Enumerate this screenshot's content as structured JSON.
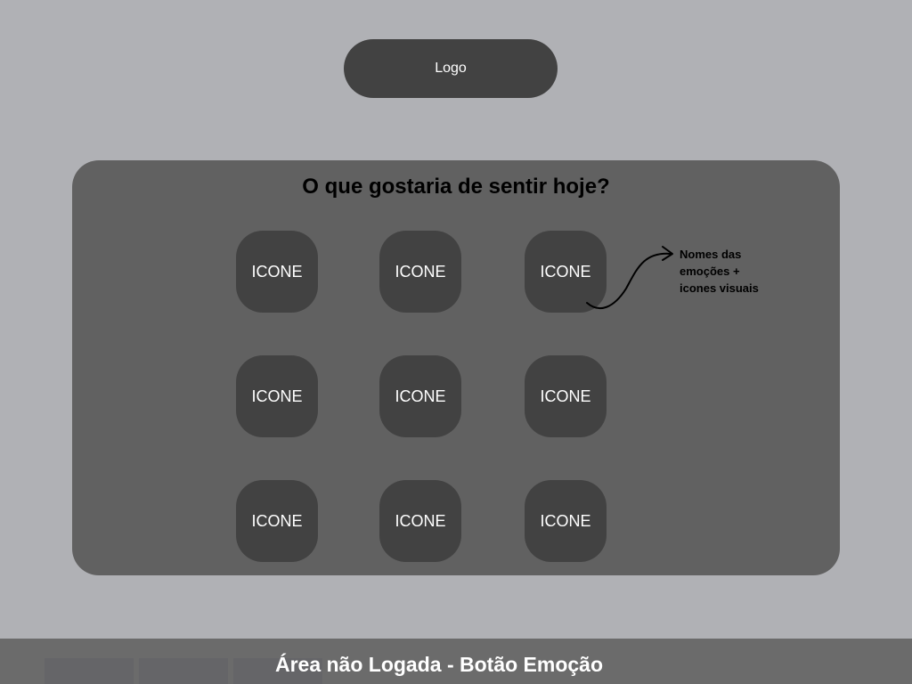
{
  "logo": {
    "label": "Logo"
  },
  "panel": {
    "title": "O que gostaria de sentir hoje?",
    "emotion_buttons": [
      {
        "label": "ICONE"
      },
      {
        "label": "ICONE"
      },
      {
        "label": "ICONE"
      },
      {
        "label": "ICONE"
      },
      {
        "label": "ICONE"
      },
      {
        "label": "ICONE"
      },
      {
        "label": "ICONE"
      },
      {
        "label": "ICONE"
      },
      {
        "label": "ICONE"
      }
    ]
  },
  "annotation": {
    "lines": [
      "Nomes das",
      "emoções +",
      "icones visuais"
    ]
  },
  "footer": {
    "title": "Área não Logada - Botão Emoção"
  },
  "colors": {
    "background": "#b0b1b5",
    "panel": "#616161",
    "button": "#424242",
    "footer": "#6b6b6b"
  }
}
